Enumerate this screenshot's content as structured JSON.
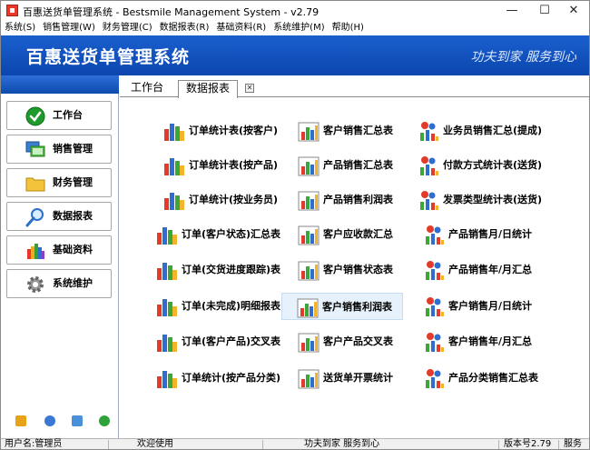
{
  "window": {
    "title": "百惠送货单管理系统 - Bestsmile Management System - v2.79",
    "minimize": "—",
    "maximize": "☐",
    "close": "✕"
  },
  "menu": [
    "系统(S)",
    "销售管理(W)",
    "财务管理(C)",
    "数据报表(R)",
    "基础资料(R)",
    "系统维护(M)",
    "帮助(H)"
  ],
  "banner": {
    "title": "百惠送货单管理系统",
    "slogan": "功夫到家 服务到心"
  },
  "nav": [
    {
      "label": "工作台",
      "icon": "check-circle-icon"
    },
    {
      "label": "销售管理",
      "icon": "monitor-icon"
    },
    {
      "label": "财务管理",
      "icon": "folder-icon"
    },
    {
      "label": "数据报表",
      "icon": "magnifier-icon"
    },
    {
      "label": "基础资料",
      "icon": "color-palette-icon"
    },
    {
      "label": "系统维护",
      "icon": "gear-icon"
    }
  ],
  "tabs": [
    {
      "label": "工作台"
    },
    {
      "label": "数据报表"
    }
  ],
  "reports": {
    "col1": [
      "订单统计表(按客户)",
      "订单统计表(按产品)",
      "订单统计(按业务员)",
      "订单(客户状态)汇总表",
      "订单(交货进度跟踪)表",
      "订单(未完成)明细报表",
      "订单(客户产品)交叉表",
      "订单统计(按产品分类)"
    ],
    "col2": [
      "客户销售汇总表",
      "产品销售汇总表",
      "产品销售利润表",
      "客户应收款汇总",
      "客户销售状态表",
      "客户销售利润表",
      "客户产品交叉表",
      "送货单开票统计"
    ],
    "col3": [
      "业务员销售汇总(提成)",
      "付款方式统计表(送货)",
      "发票类型统计表(送货)",
      "产品销售月/日统计",
      "产品销售年/月汇总",
      "客户销售月/日统计",
      "客户销售年/月汇总",
      "产品分类销售汇总表"
    ],
    "selected": "客户销售利润表"
  },
  "status": {
    "user": "用户名:管理员",
    "welcome": "欢迎使用",
    "slogan": "功夫到家 服务到心",
    "version": "版本号2.79",
    "extra": "服务"
  },
  "colors": {
    "banner": "#0b46ad",
    "selection": "#e7f1fb"
  }
}
